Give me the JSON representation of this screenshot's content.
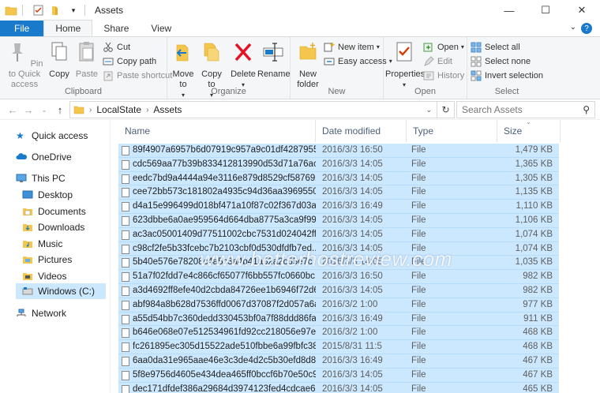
{
  "window": {
    "title": "Assets",
    "controls": {
      "minimize": "—",
      "maximize": "☐",
      "close": "✕"
    }
  },
  "tabs": [
    {
      "label": "File"
    },
    {
      "label": "Home"
    },
    {
      "label": "Share"
    },
    {
      "label": "View"
    }
  ],
  "ribbon": {
    "clipboard": {
      "label": "Clipboard",
      "pin": "Pin to Quick access",
      "copy": "Copy",
      "paste": "Paste",
      "cut": "Cut",
      "copy_path": "Copy path",
      "paste_shortcut": "Paste shortcut"
    },
    "organize": {
      "label": "Organize",
      "move_to": "Move to",
      "copy_to": "Copy to",
      "delete": "Delete",
      "rename": "Rename"
    },
    "new": {
      "label": "New",
      "new_folder": "New folder",
      "new_item": "New item",
      "easy_access": "Easy access"
    },
    "open": {
      "label": "Open",
      "properties": "Properties",
      "open": "Open",
      "edit": "Edit",
      "history": "History"
    },
    "select": {
      "label": "Select",
      "select_all": "Select all",
      "select_none": "Select none",
      "invert_selection": "Invert selection"
    }
  },
  "address": {
    "path": [
      "LocalState",
      "Assets"
    ],
    "search_placeholder": "Search Assets"
  },
  "nav": [
    {
      "label": "Quick access"
    },
    {
      "label": "OneDrive"
    },
    {
      "label": "This PC"
    },
    {
      "label": "Desktop"
    },
    {
      "label": "Documents"
    },
    {
      "label": "Downloads"
    },
    {
      "label": "Music"
    },
    {
      "label": "Pictures"
    },
    {
      "label": "Videos"
    },
    {
      "label": "Windows (C:)"
    },
    {
      "label": "Network"
    }
  ],
  "columns": {
    "name": "Name",
    "date": "Date modified",
    "type": "Type",
    "size": "Size"
  },
  "files": [
    {
      "name": "89f4907a6957b6d07919c957a9c01df4287955...",
      "date": "2016/3/3 16:50",
      "type": "File",
      "size": "1,479 KB"
    },
    {
      "name": "cdc569aa77b39b833412813990d53d71a76ac...",
      "date": "2016/3/3 14:05",
      "type": "File",
      "size": "1,365 KB"
    },
    {
      "name": "eedc7bd9a4444a94e3116e879d8529cf587692...",
      "date": "2016/3/3 14:05",
      "type": "File",
      "size": "1,305 KB"
    },
    {
      "name": "cee72bb573c181802a4935c94d36aa3969550...",
      "date": "2016/3/3 14:05",
      "type": "File",
      "size": "1,135 KB"
    },
    {
      "name": "d4a15e996499d018bf471a10f87c02f367d03a...",
      "date": "2016/3/3 16:49",
      "type": "File",
      "size": "1,110 KB"
    },
    {
      "name": "623dbbe6a0ae959564d664dba8775a3ca9f995...",
      "date": "2016/3/3 14:05",
      "type": "File",
      "size": "1,106 KB"
    },
    {
      "name": "ac3ac05001409d77511002cbc7531d024042ff...",
      "date": "2016/3/3 14:05",
      "type": "File",
      "size": "1,074 KB"
    },
    {
      "name": "c98cf2fe5b33fcebc7b2103cbf0d530dfdfb7ed...",
      "date": "2016/3/3 14:05",
      "type": "File",
      "size": "1,074 KB"
    },
    {
      "name": "5b40e576e78208c4a5c3a4b41a52a2c55e7c...",
      "date": "2016/3/3 14:05",
      "type": "File",
      "size": "1,035 KB"
    },
    {
      "name": "51a7f02fdd7e4c866cf65077f6bb557fc0660bc...",
      "date": "2016/3/3 16:50",
      "type": "File",
      "size": "982 KB"
    },
    {
      "name": "a3d4692ff8efe40d2cbda84726ee1b6946f72d6...",
      "date": "2016/3/3 14:05",
      "type": "File",
      "size": "982 KB"
    },
    {
      "name": "abf984a8b628d7536ffd0067d37087f2d057a6a...",
      "date": "2016/3/2 1:00",
      "type": "File",
      "size": "977 KB"
    },
    {
      "name": "a55d54bb7c360dedd330453bf0a7f88ddd86fa...",
      "date": "2016/3/3 16:49",
      "type": "File",
      "size": "911 KB"
    },
    {
      "name": "b646e068e07e512534961fd92cc218056e97e3...",
      "date": "2016/3/2 1:00",
      "type": "File",
      "size": "468 KB"
    },
    {
      "name": "fc261895ec305d15522ade510fbbe6a99fbfc38...",
      "date": "2015/8/31 11:5",
      "type": "File",
      "size": "468 KB"
    },
    {
      "name": "6aa0da31e965aae46e3c3de4d2c5b30efd8d83...",
      "date": "2016/3/3 16:49",
      "type": "File",
      "size": "467 KB"
    },
    {
      "name": "5f8e9756d4605e434dea465ff0bccf6b70e50c9...",
      "date": "2016/3/3 14:05",
      "type": "File",
      "size": "467 KB"
    },
    {
      "name": "dec171dfdef386a29684d3974123fed4cdcae6...",
      "date": "2016/3/3 14:05",
      "type": "File",
      "size": "465 KB"
    }
  ],
  "watermark": "www.betterhostreview.com",
  "colors": {
    "accent": "#1979ca",
    "selection": "#cce8ff",
    "folder": "#f4c64e"
  }
}
